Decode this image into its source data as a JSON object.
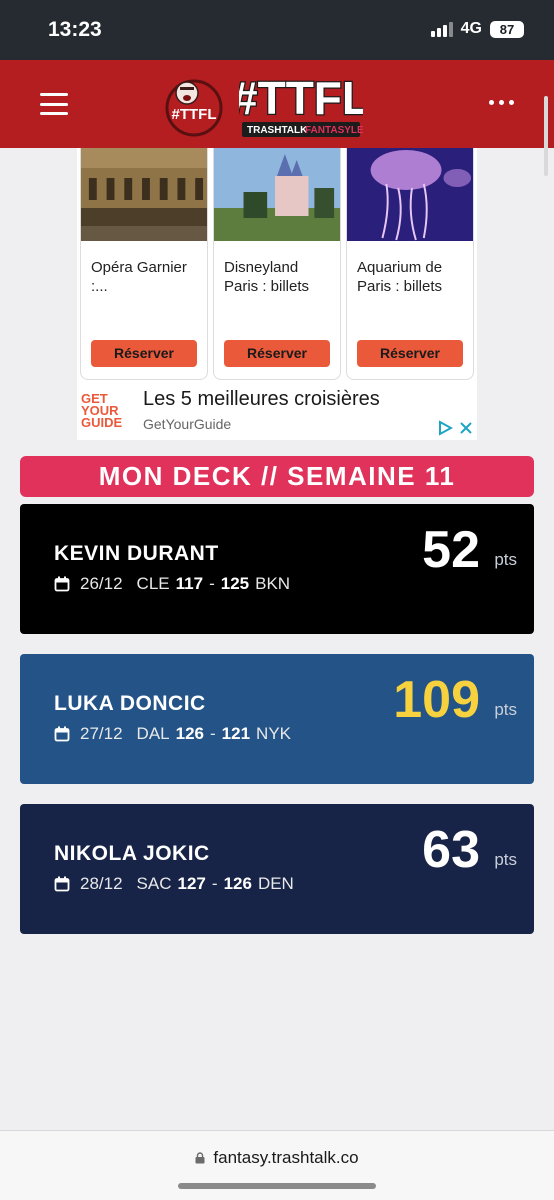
{
  "status_bar": {
    "time": "13:23",
    "network": "4G",
    "battery": "87"
  },
  "header": {
    "menu_icon": "hamburger-icon",
    "more_icon": "more-dots-icon",
    "logo": {
      "mascot_text": "#TTFL",
      "wordmark": "#TTFL",
      "tagline": "TRASHTALK FANTASY LEAGUE",
      "tagline_part1": "TRASHTALK",
      "tagline_part2": "FANTASYLEAGUE"
    }
  },
  "ad": {
    "cards": [
      {
        "title": "Opéra Garnier :...",
        "button": "Réserver"
      },
      {
        "title": "Disneyland Paris : billets",
        "button": "Réserver"
      },
      {
        "title": "Aquarium de Paris : billets",
        "button": "Réserver"
      }
    ],
    "brand_logo": "GET YOUR GUIDE",
    "brand_logo_lines": [
      "GET",
      "YOUR",
      "GUIDE"
    ],
    "headline": "Les 5 meilleures croisières",
    "source": "GetYourGuide",
    "adchoices_icon": "adchoices-icon",
    "close_icon": "close-icon"
  },
  "deck": {
    "title": "MON DECK // SEMAINE 11",
    "pts_label": "pts",
    "cards": [
      {
        "name": "KEVIN DURANT",
        "date": "26/12",
        "team": "CLE",
        "team_score": "117",
        "separator": "-",
        "opp_score": "125",
        "opp": "BKN",
        "points": "52",
        "bg": "#000000",
        "points_color": "#ffffff"
      },
      {
        "name": "LUKA DONCIC",
        "date": "27/12",
        "team": "DAL",
        "team_score": "126",
        "separator": "-",
        "opp_score": "121",
        "opp": "NYK",
        "points": "109",
        "bg": "#245487",
        "points_color": "#f7d23e"
      },
      {
        "name": "NIKOLA JOKIC",
        "date": "28/12",
        "team": "SAC",
        "team_score": "127",
        "separator": "-",
        "opp_score": "126",
        "opp": "DEN",
        "points": "63",
        "bg": "#172447",
        "points_color": "#ffffff"
      }
    ]
  },
  "browser": {
    "url": "fantasy.trashtalk.co",
    "lock_icon": "lock-icon"
  },
  "colors": {
    "header": "#b41e21",
    "deck_banner": "#e0325a",
    "ad_button": "#ea5a3a"
  }
}
